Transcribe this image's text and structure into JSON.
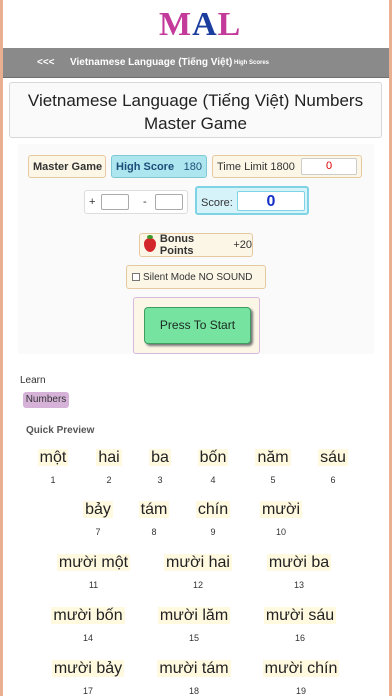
{
  "logo": {
    "m": "M",
    "a": "A",
    "l": "L"
  },
  "nav": {
    "back": "<<<",
    "title": "Vietnamese Language (Tiếng Việt)",
    "high_scores": "High Scores"
  },
  "page": {
    "title": "Vietnamese Language (Tiếng Việt) Numbers Master Game"
  },
  "game": {
    "master_label": "Master Game",
    "high_score_label": "High Score",
    "high_score_value": "180",
    "time_limit_label": "Time Limit 1800",
    "timer_value": "0",
    "plus": "+",
    "minus": "-",
    "score_label": "Score:",
    "score_value": "0",
    "bonus_label": "Bonus Points",
    "bonus_value": "+20",
    "silent_label": "Silent Mode NO SOUND",
    "start_label": "Press To Start"
  },
  "learn": {
    "label": "Learn",
    "tag": "Numbers",
    "preview_label": "Quick Preview"
  },
  "tiles": [
    {
      "word": "một",
      "num": "1"
    },
    {
      "word": "hai",
      "num": "2"
    },
    {
      "word": "ba",
      "num": "3"
    },
    {
      "word": "bốn",
      "num": "4"
    },
    {
      "word": "năm",
      "num": "5"
    },
    {
      "word": "sáu",
      "num": "6"
    },
    {
      "word": "bảy",
      "num": "7"
    },
    {
      "word": "tám",
      "num": "8"
    },
    {
      "word": "chín",
      "num": "9"
    },
    {
      "word": "mười",
      "num": "10"
    },
    {
      "word": "mười một",
      "num": "11"
    },
    {
      "word": "mười hai",
      "num": "12"
    },
    {
      "word": "mười ba",
      "num": "13"
    },
    {
      "word": "mười bốn",
      "num": "14"
    },
    {
      "word": "mười lăm",
      "num": "15"
    },
    {
      "word": "mười sáu",
      "num": "16"
    },
    {
      "word": "mười bảy",
      "num": "17"
    },
    {
      "word": "mười tám",
      "num": "18"
    },
    {
      "word": "mười chín",
      "num": "19"
    }
  ],
  "colors": {
    "accent_start": "#76e3a0",
    "score_blue": "#1530c8",
    "timer_red": "#dd0000",
    "nav_gray": "#8a8a8a"
  },
  "icons": {
    "bonus": "strawberry-icon"
  }
}
